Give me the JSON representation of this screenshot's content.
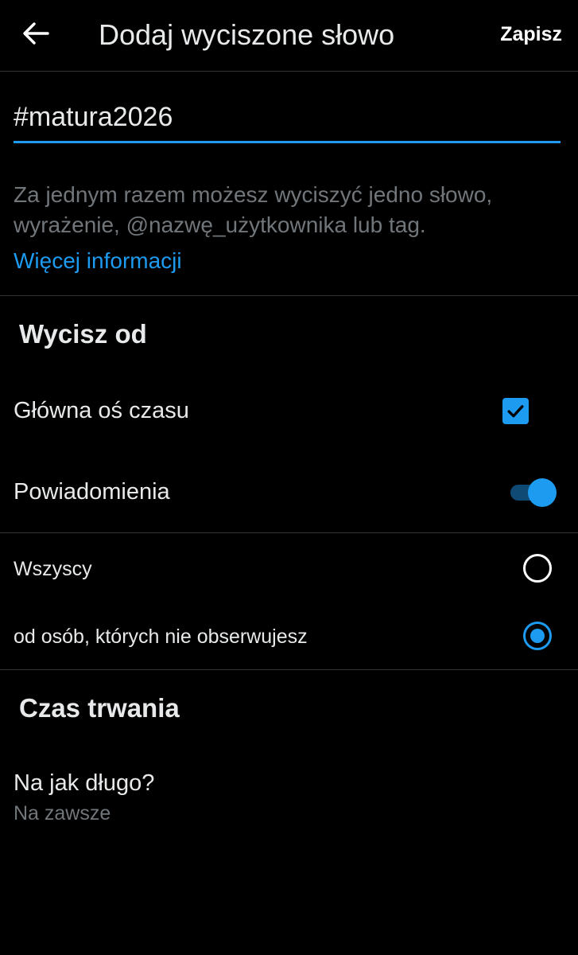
{
  "header": {
    "title": "Dodaj wyciszone słowo",
    "save_label": "Zapisz",
    "back_icon": "arrow-left-icon"
  },
  "word": {
    "value": "#matura2026"
  },
  "hint": {
    "text": "Za jednym razem możesz wyciszyć jedno słowo, wyrażenie, @nazwę_użytkownika lub tag.",
    "link": "Więcej informacji"
  },
  "mute_from": {
    "title": "Wycisz od",
    "home_timeline": {
      "label": "Główna oś czasu",
      "checked": true
    },
    "notifications": {
      "label": "Powiadomienia",
      "enabled": true
    },
    "options": [
      {
        "label": "Wszyscy",
        "selected": false
      },
      {
        "label": "od osób, których nie obserwujesz",
        "selected": true
      }
    ]
  },
  "duration": {
    "title": "Czas trwania",
    "question": "Na jak długo?",
    "value": "Na zawsze"
  },
  "colors": {
    "background": "#000000",
    "accent": "#1d9bf0",
    "text_primary": "#e7e9ea",
    "text_secondary": "#71767b",
    "divider": "#2f3336"
  }
}
